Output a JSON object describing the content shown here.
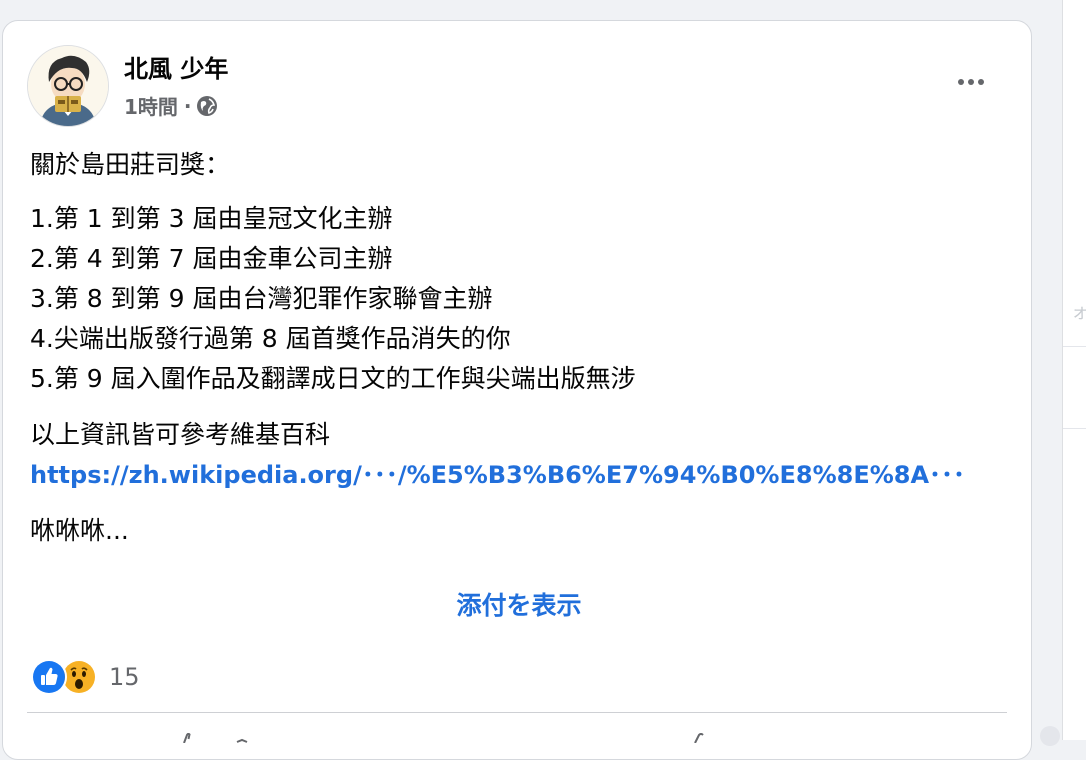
{
  "post": {
    "author_name": "北風 少年",
    "timestamp": "1時間",
    "separator": "·",
    "audience_icon": "globe-icon",
    "more_icon": "more-options-icon",
    "intro": "關於島田莊司獎：",
    "list_items": [
      "1.第 1 到第 3 屆由皇冠文化主辦",
      "2.第 4 到第 7 屆由金車公司主辦",
      "3.第 8 到第 9 屆由台灣犯罪作家聯會主辦",
      "4.尖端出版發行過第 8 屆首獎作品消失的你",
      "5.第 9 屆入圍作品及翻譯成日文的工作與尖端出版無涉"
    ],
    "reference_text": "以上資訊皆可參考維基百科",
    "link_text": "https://zh.wikipedia.org/･･･/%E5%B3%B6%E7%94%B0%E8%8E%8A･･･",
    "outro": "咻咻咻..."
  },
  "attachment": {
    "label": "添付を表示"
  },
  "reactions": {
    "icons": [
      "like-icon",
      "wow-icon"
    ],
    "count": "15"
  },
  "colors": {
    "link": "#216fdb",
    "secondary_text": "#65676b",
    "primary_text": "#050505",
    "like": "#1877f2",
    "wow": "#f7b125"
  }
}
